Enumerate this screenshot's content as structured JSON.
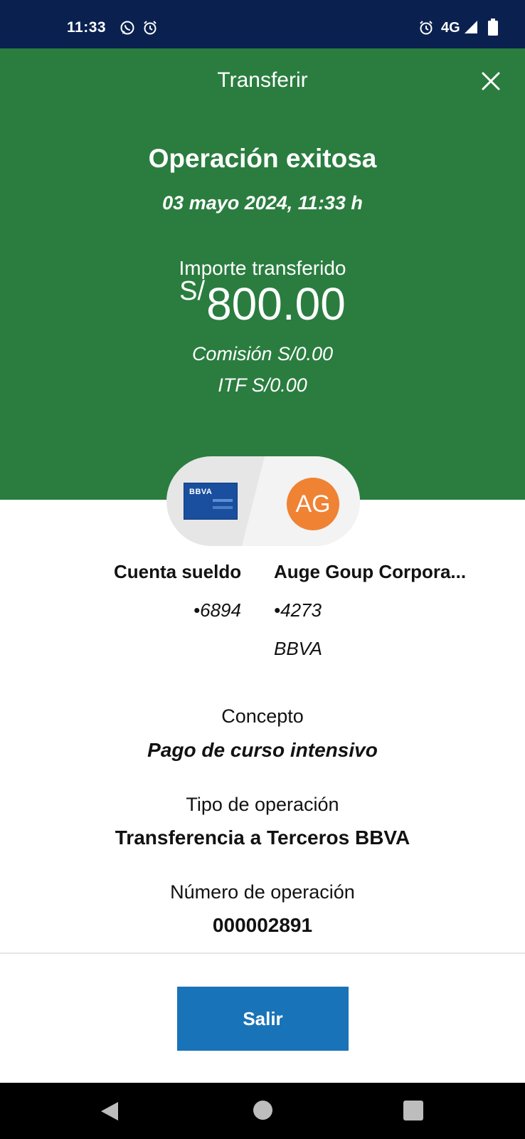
{
  "status_bar": {
    "time": "11:33",
    "network": "4G",
    "icons": [
      "whatsapp-icon",
      "alarm-icon",
      "signal-icon",
      "battery-icon"
    ]
  },
  "header": {
    "title": "Transferir",
    "close_icon": "close-icon"
  },
  "result": {
    "headline": "Operación exitosa",
    "datetime": "03 mayo 2024, 11:33 h",
    "amount_label": "Importe transferido",
    "currency": "S/",
    "amount": "800.00",
    "commission": "Comisión  S/0.00",
    "itf": "ITF  S/0.00"
  },
  "transfer": {
    "origin": {
      "name": "Cuenta sueldo",
      "number": "•6894",
      "card_brand": "BBVA"
    },
    "destination": {
      "initials": "AG",
      "name": "Auge Goup Corpora...",
      "number": "•4273",
      "bank": "BBVA"
    }
  },
  "details": {
    "concept_label": "Concepto",
    "concept_value": "Pago de curso intensivo",
    "type_label": "Tipo de operación",
    "type_value": "Transferencia a Terceros BBVA",
    "number_label": "Número de operación",
    "number_value": "000002891"
  },
  "footer": {
    "exit_label": "Salir"
  },
  "colors": {
    "status_bar": "#0a2150",
    "header_green": "#2a7d3f",
    "button_blue": "#1973b8",
    "avatar_orange": "#f08234",
    "card_blue": "#1a4f9f"
  }
}
